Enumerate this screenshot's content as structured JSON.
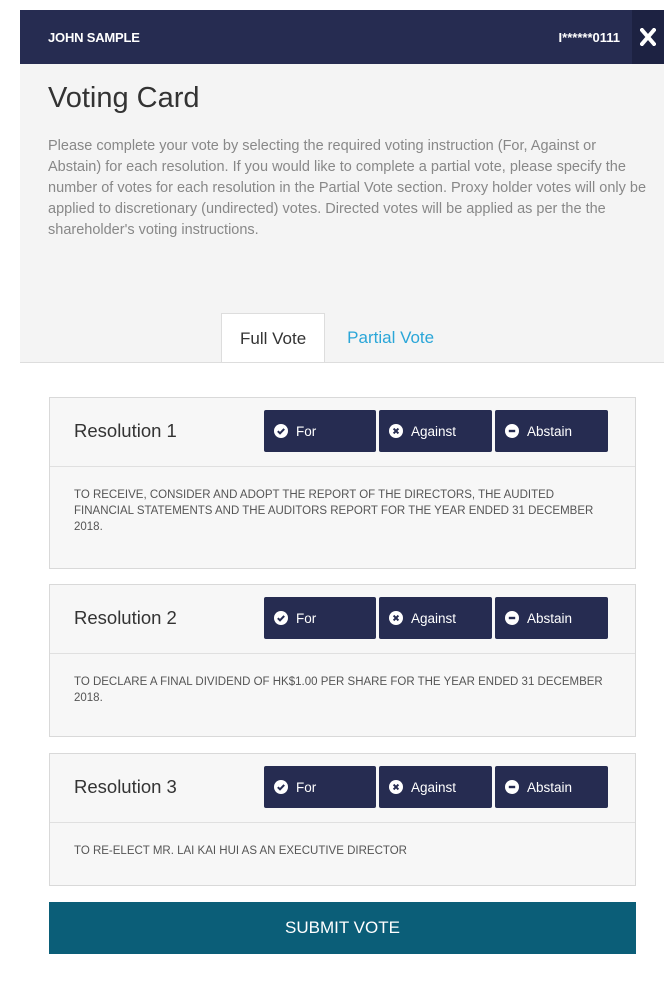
{
  "header": {
    "user_name": "JOHN SAMPLE",
    "account": "I******0111",
    "close_icon": "close-icon"
  },
  "card": {
    "title": "Voting Card",
    "description": "Please complete your vote by selecting the required voting instruction (For, Against or Abstain) for each resolution. If you would like to complete a partial vote, please specify the number of votes for each resolution in the Partial Vote section. Proxy holder votes will only be applied to discretionary (undirected) votes. Directed votes will be applied as per the the shareholder's voting instructions."
  },
  "tabs": [
    {
      "label": "Full Vote",
      "active": true
    },
    {
      "label": "Partial Vote",
      "active": false
    }
  ],
  "buttons": {
    "for": "For",
    "against": "Against",
    "abstain": "Abstain"
  },
  "resolutions": [
    {
      "title": "Resolution 1",
      "text": "TO RECEIVE, CONSIDER AND ADOPT THE REPORT OF THE DIRECTORS, THE AUDITED FINANCIAL STATEMENTS AND THE AUDITORS REPORT FOR THE YEAR ENDED 31 DECEMBER 2018."
    },
    {
      "title": "Resolution 2",
      "text": "TO DECLARE A FINAL DIVIDEND OF HK$1.00 PER SHARE FOR THE YEAR ENDED 31 DECEMBER 2018."
    },
    {
      "title": "Resolution 3",
      "text": "TO RE-ELECT MR. LAI KAI HUI AS AN EXECUTIVE DIRECTOR"
    }
  ],
  "submit_label": "SUBMIT VOTE",
  "colors": {
    "navy": "#262c51",
    "submit": "#0b5e78",
    "tab_link": "#2aa6d8"
  }
}
